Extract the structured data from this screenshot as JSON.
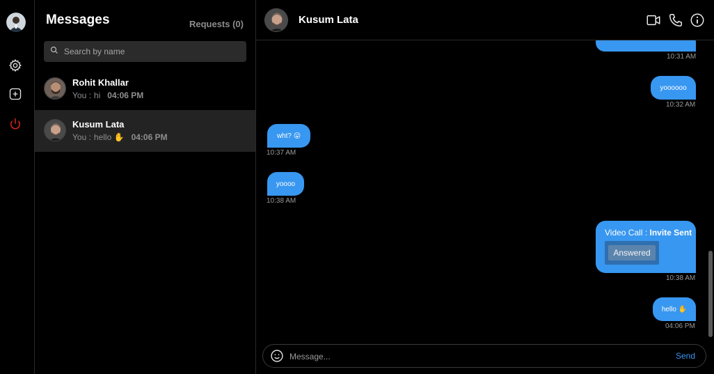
{
  "list": {
    "title": "Messages",
    "requests": "Requests (0)",
    "search_placeholder": "Search by name",
    "conversations": [
      {
        "name": "Rohit Khallar",
        "you": "You :",
        "preview": "hi",
        "time": "04:06 PM"
      },
      {
        "name": "Kusum Lata",
        "you": "You :",
        "preview": "hello ✋",
        "time": "04:06 PM"
      }
    ]
  },
  "chat": {
    "title": "Kusum Lata",
    "messages": {
      "m0_time": "10:31 AM",
      "m1_text": "yoooooo",
      "m1_time": "10:32 AM",
      "m2_text": "wht? 😛",
      "m2_time": "10:37 AM",
      "m3_text": "yoooo",
      "m3_time": "10:38 AM",
      "m4_label": "Video Call :",
      "m4_status": "Invite Sent",
      "m4_answer": "Answered",
      "m4_time": "10:38 AM",
      "m5_text": "hello ✋",
      "m5_time": "04:06 PM"
    },
    "composer_placeholder": "Message...",
    "send_label": "Send"
  },
  "colors": {
    "accent": "#3897f0",
    "power": "#e0241b",
    "background": "#000000",
    "active_row": "#232323"
  },
  "icons": [
    "avatar",
    "gear-icon",
    "plus-square-icon",
    "power-icon",
    "search-icon",
    "video-icon",
    "phone-icon",
    "info-icon",
    "smiley-icon"
  ]
}
